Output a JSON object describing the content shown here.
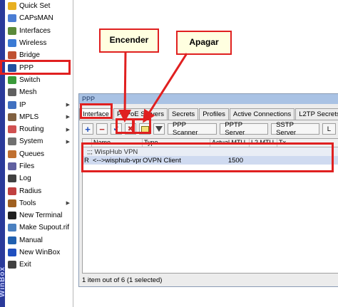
{
  "sidebar": {
    "vertical_label": "WinBox",
    "items": [
      {
        "label": "Quick Set",
        "icon": "quick-set-icon",
        "arrow": false
      },
      {
        "label": "CAPsMAN",
        "icon": "capsman-icon",
        "arrow": false
      },
      {
        "label": "Interfaces",
        "icon": "interfaces-icon",
        "arrow": false
      },
      {
        "label": "Wireless",
        "icon": "wireless-icon",
        "arrow": false
      },
      {
        "label": "Bridge",
        "icon": "bridge-icon",
        "arrow": false
      },
      {
        "label": "PPP",
        "icon": "ppp-icon",
        "arrow": false
      },
      {
        "label": "Switch",
        "icon": "switch-icon",
        "arrow": false
      },
      {
        "label": "Mesh",
        "icon": "mesh-icon",
        "arrow": false
      },
      {
        "label": "IP",
        "icon": "ip-icon",
        "arrow": true
      },
      {
        "label": "MPLS",
        "icon": "mpls-icon",
        "arrow": true
      },
      {
        "label": "Routing",
        "icon": "routing-icon",
        "arrow": true
      },
      {
        "label": "System",
        "icon": "system-icon",
        "arrow": true
      },
      {
        "label": "Queues",
        "icon": "queues-icon",
        "arrow": false
      },
      {
        "label": "Files",
        "icon": "files-icon",
        "arrow": false
      },
      {
        "label": "Log",
        "icon": "log-icon",
        "arrow": false
      },
      {
        "label": "Radius",
        "icon": "radius-icon",
        "arrow": false
      },
      {
        "label": "Tools",
        "icon": "tools-icon",
        "arrow": true
      },
      {
        "label": "New Terminal",
        "icon": "terminal-icon",
        "arrow": false
      },
      {
        "label": "Make Supout.rif",
        "icon": "supout-icon",
        "arrow": false
      },
      {
        "label": "Manual",
        "icon": "manual-icon",
        "arrow": false
      },
      {
        "label": "New WinBox",
        "icon": "winbox-icon",
        "arrow": false
      },
      {
        "label": "Exit",
        "icon": "exit-icon",
        "arrow": false
      }
    ]
  },
  "window": {
    "title": "PPP",
    "tabs": [
      "Interface",
      "PPPoE Servers",
      "Secrets",
      "Profiles",
      "Active Connections",
      "L2TP Secrets"
    ],
    "toolbar": {
      "add": "+",
      "remove": "−",
      "enable": "✔",
      "disable": "✖",
      "buttons": [
        "PPP Scanner",
        "PPTP Server",
        "SSTP Server",
        "L"
      ]
    },
    "columns": [
      "Name",
      "Type",
      "Actual MTU",
      "L2 MTU",
      "Tx"
    ],
    "comment_row": ";;; WispHub VPN",
    "rows": [
      {
        "flag": "R",
        "name": "<-->wisphub-vpn",
        "type": "OVPN Client",
        "mtu": "1500",
        "l2mtu": "",
        "tx": ""
      }
    ],
    "status": "1 item out of 6 (1 selected)"
  },
  "callouts": {
    "enable_label": "Encender",
    "disable_label": "Apagar"
  },
  "colors": {
    "highlight": "#e02020",
    "callout_bg": "#ffffe0",
    "sidebar_strip": "#2a3a9a"
  }
}
